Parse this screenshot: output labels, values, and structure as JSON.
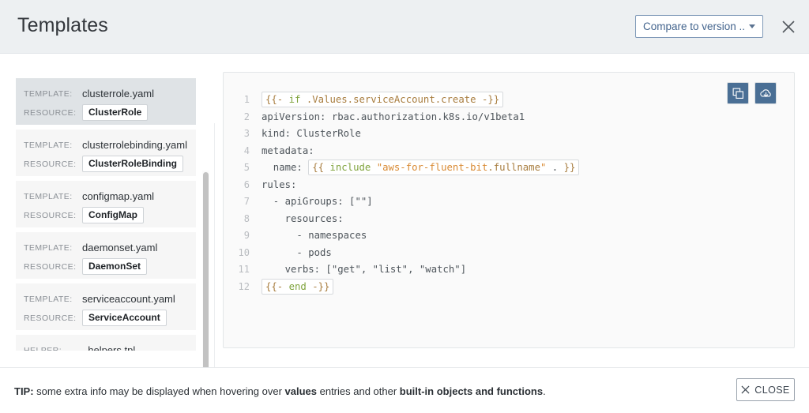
{
  "header": {
    "title": "Templates",
    "compare_label": "Compare to version ...",
    "close_icon": "close-x-icon",
    "caret_icon": "chevron-down-icon"
  },
  "sidebar": {
    "items": [
      {
        "key": "TEMPLATE:",
        "file": "clusterrole.yaml",
        "res_key": "RESOURCE:",
        "resource": "ClusterRole",
        "selected": true
      },
      {
        "key": "TEMPLATE:",
        "file": "clusterrolebinding.yaml",
        "res_key": "RESOURCE:",
        "resource": "ClusterRoleBinding",
        "selected": false
      },
      {
        "key": "TEMPLATE:",
        "file": "configmap.yaml",
        "res_key": "RESOURCE:",
        "resource": "ConfigMap",
        "selected": false
      },
      {
        "key": "TEMPLATE:",
        "file": "daemonset.yaml",
        "res_key": "RESOURCE:",
        "resource": "DaemonSet",
        "selected": false
      },
      {
        "key": "TEMPLATE:",
        "file": "serviceaccount.yaml",
        "res_key": "RESOURCE:",
        "resource": "ServiceAccount",
        "selected": false
      },
      {
        "key": "HELPER:",
        "file": "_helpers.tpl",
        "res_key": "",
        "resource": "",
        "selected": false
      }
    ]
  },
  "code_panel": {
    "actions": [
      {
        "icon": "copy-icon",
        "name": "copy-button"
      },
      {
        "icon": "cloud-download-icon",
        "name": "download-button"
      }
    ],
    "lines": [
      {
        "n": "1",
        "text": "{{- if .Values.serviceAccount.create -}}",
        "boxed": true
      },
      {
        "n": "2",
        "text": "apiVersion: rbac.authorization.k8s.io/v1beta1",
        "boxed": false
      },
      {
        "n": "3",
        "text": "kind: ClusterRole",
        "boxed": false
      },
      {
        "n": "4",
        "text": "metadata:",
        "boxed": false
      },
      {
        "n": "5",
        "text": "  name: {{ include \"aws-for-fluent-bit.fullname\" . }}",
        "boxed": true
      },
      {
        "n": "6",
        "text": "rules:",
        "boxed": false
      },
      {
        "n": "7",
        "text": "  - apiGroups: [\"\"]",
        "boxed": false
      },
      {
        "n": "8",
        "text": "    resources:",
        "boxed": false
      },
      {
        "n": "9",
        "text": "      - namespaces",
        "boxed": false
      },
      {
        "n": "10",
        "text": "      - pods",
        "boxed": false
      },
      {
        "n": "11",
        "text": "    verbs: [\"get\", \"list\", \"watch\"]",
        "boxed": false
      },
      {
        "n": "12",
        "text": "{{- end -}}",
        "boxed": true
      }
    ]
  },
  "footer": {
    "tip_prefix": "TIP:",
    "tip_part1": " some extra info may be displayed when hovering over ",
    "tip_bold1": "values",
    "tip_part2": " entries and other ",
    "tip_bold2": "built-in objects and functions",
    "tip_suffix": ".",
    "close_label": "CLOSE",
    "close_icon": "close-x-icon"
  },
  "colors": {
    "header_bg": "#edf0f2",
    "accent_blue": "#4a6f95",
    "link_blue": "#43648d",
    "selected_card": "#dfe3e6",
    "card_bg": "#f6f6f6",
    "code_bg": "#fafafa"
  }
}
